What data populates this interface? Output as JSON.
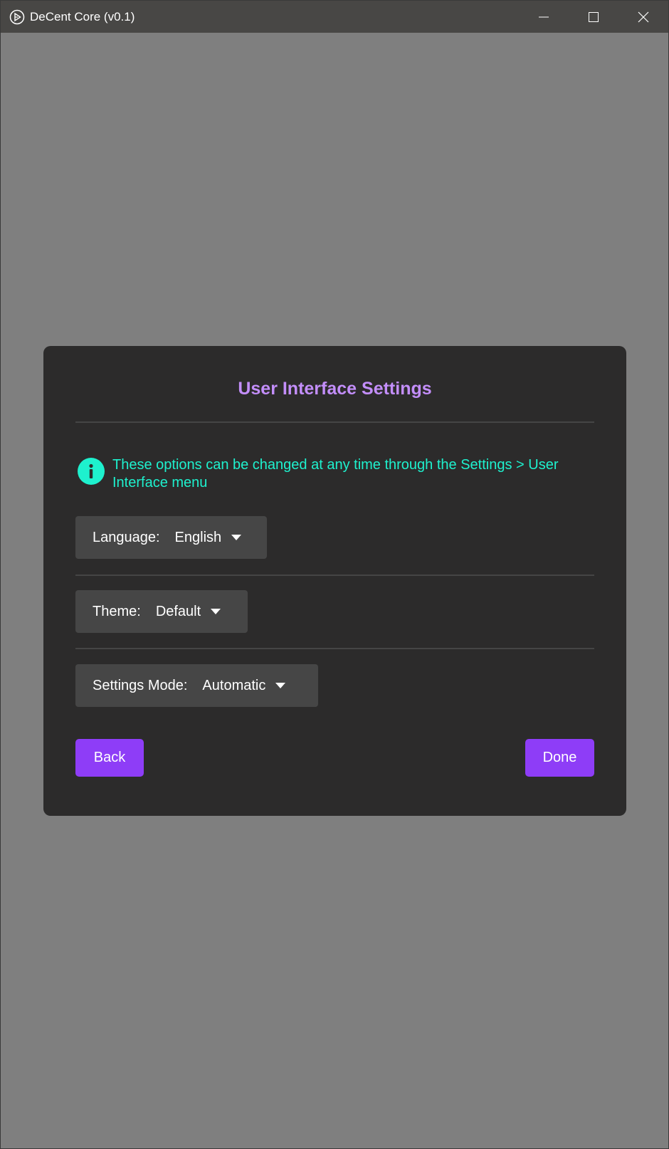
{
  "window": {
    "title": "DeCent Core (v0.1)"
  },
  "dialog": {
    "title": "User Interface Settings",
    "info_text": "These options can be changed at any time through the Settings > User Interface menu",
    "language": {
      "label": "Language:",
      "value": "English"
    },
    "theme": {
      "label": "Theme:",
      "value": "Default"
    },
    "settings_mode": {
      "label": "Settings Mode:",
      "value": "Automatic"
    },
    "back_label": "Back",
    "done_label": "Done"
  },
  "colors": {
    "accent": "#8e3df7",
    "title": "#c38efa",
    "info": "#1ef1ce",
    "panel": "#2c2b2b",
    "backdrop": "#7f7f7f"
  },
  "icons": [
    "app-logo-icon",
    "minimize-icon",
    "maximize-icon",
    "close-icon",
    "info-icon",
    "chevron-down-icon"
  ]
}
